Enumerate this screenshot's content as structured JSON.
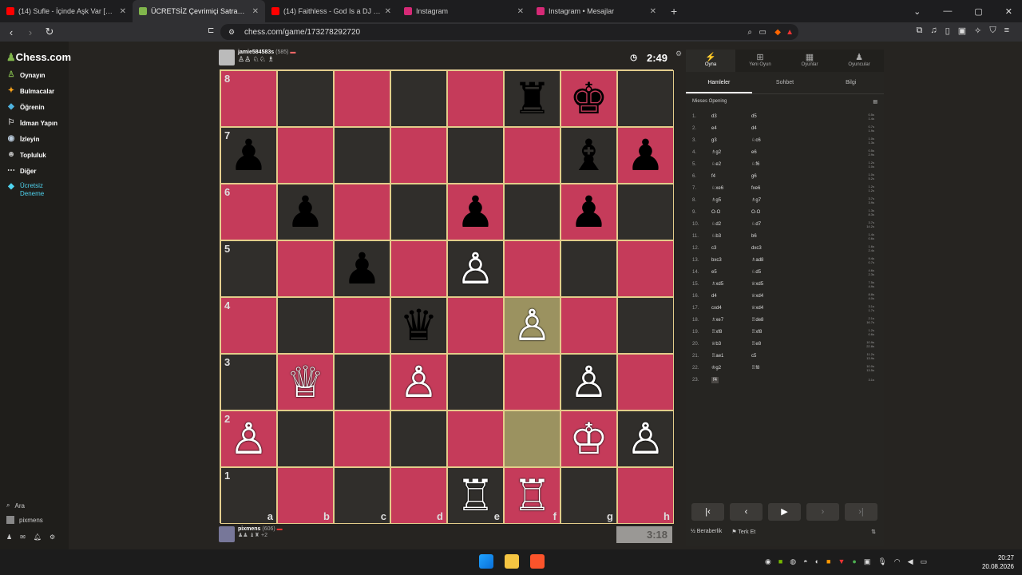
{
  "browser": {
    "tabs": [
      {
        "label": "(14) Sufle - İçinde Aşk Var [Officia",
        "color": "#ff0000",
        "active": false
      },
      {
        "label": "ÜCRETSİZ Çevrimiçi Satranç O",
        "color": "#81b64c",
        "active": true
      },
      {
        "label": "(14) Faithless - God Is a DJ (Official V",
        "color": "#ff0000",
        "active": false
      },
      {
        "label": "Instagram",
        "color": "#d62976",
        "active": false
      },
      {
        "label": "Instagram • Mesajlar",
        "color": "#d62976",
        "active": false
      }
    ],
    "url": "chess.com/game/173278292720"
  },
  "sidebar": {
    "logo": "Chess.com",
    "items": [
      "Oynayın",
      "Bulmacalar",
      "Öğrenin",
      "İdman Yapın",
      "İzleyin",
      "Topluluk",
      "Diğer",
      "Ücretsiz Deneme"
    ],
    "search": "Ara",
    "user": "pixmens"
  },
  "top_player": {
    "name": "jamie584583s",
    "rating": "(585)",
    "timer": "2:49"
  },
  "bottom_player": {
    "name": "pixmens",
    "rating": "(606)",
    "extra": "+2",
    "timer": "3:18"
  },
  "board": {
    "ranks": [
      "8",
      "7",
      "6",
      "5",
      "4",
      "3",
      "2",
      "1"
    ],
    "files": [
      "a",
      "b",
      "c",
      "d",
      "e",
      "f",
      "g",
      "h"
    ],
    "squares": [
      [
        "",
        "",
        "",
        "",
        "",
        "♜",
        "♚",
        ""
      ],
      [
        "♟",
        "",
        "",
        "",
        "",
        "",
        "♝",
        "♟"
      ],
      [
        "",
        "♟",
        "",
        "",
        "♟",
        "",
        "♟",
        ""
      ],
      [
        "",
        "",
        "♟",
        "",
        "♙",
        "",
        "",
        ""
      ],
      [
        "",
        "",
        "",
        "♛",
        "",
        "♙",
        "",
        ""
      ],
      [
        "",
        "♕",
        "",
        "♙",
        "",
        "",
        "♙",
        ""
      ],
      [
        "♙",
        "",
        "",
        "",
        "",
        "",
        "♔",
        "♙"
      ],
      [
        "",
        "",
        "",
        "",
        "♖",
        "♖",
        "",
        ""
      ]
    ]
  },
  "panel": {
    "top_tabs": [
      "Oyna",
      "Yeni Oyun",
      "Oyunlar",
      "Oyuncular"
    ],
    "sub_tabs": [
      "Hamleler",
      "Sohbet",
      "Bilgi"
    ],
    "opening": "Mieses Opening",
    "moves": [
      [
        "1.",
        "d3",
        "d5",
        "0.5s",
        "1.4s"
      ],
      [
        "2.",
        "e4",
        "d4",
        "0.7s",
        "1.9s"
      ],
      [
        "3.",
        "g3",
        "♘c6",
        "1.0s",
        "1.3s"
      ],
      [
        "4.",
        "♗g2",
        "e6",
        "0.5s",
        "2.9s"
      ],
      [
        "5.",
        "♘e2",
        "♘f6",
        "1.2s",
        "1.0s"
      ],
      [
        "6.",
        "f4",
        "g6",
        "1.0s",
        "5.2s"
      ],
      [
        "7.",
        "♘xe6",
        "fxe6",
        "1.2s",
        "1.2s"
      ],
      [
        "8.",
        "♗g5",
        "♗g7",
        "3.7s",
        "3.9s"
      ],
      [
        "9.",
        "O-O",
        "O-O",
        "1.3s",
        "8.3s"
      ],
      [
        "10.",
        "♘d2",
        "♘d7",
        "3.7s",
        "14.2s"
      ],
      [
        "11.",
        "♘b3",
        "b6",
        "1.4s",
        "0.6s"
      ],
      [
        "12.",
        "c3",
        "dxc3",
        "1.6s",
        "2.4s"
      ],
      [
        "13.",
        "bxc3",
        "♗ad8",
        "9.4s",
        "0.7s"
      ],
      [
        "14.",
        "e5",
        "♘d5",
        "4.6s",
        "2.3s"
      ],
      [
        "15.",
        "♗xd5",
        "♕xd5",
        "7.5s",
        "4.9s"
      ],
      [
        "16.",
        "d4",
        "♕xd4",
        "8.8s",
        "4.0s"
      ],
      [
        "17.",
        "cxd4",
        "♕xd4",
        "3.1s",
        "1.7s"
      ],
      [
        "18.",
        "♗xe7",
        "♖de8",
        "2.1s",
        "16.7s"
      ],
      [
        "19.",
        "♖xf8",
        "♖xf8",
        "1.2s",
        "0.6s"
      ],
      [
        "20.",
        "♕b3",
        "♖e8",
        "10.9s",
        "22.8s"
      ],
      [
        "21.",
        "♖ae1",
        "c5",
        "11.2s",
        "13.9s"
      ],
      [
        "22.",
        "♔g2",
        "♖f8",
        "10.0s",
        "13.5s"
      ],
      [
        "23.",
        "f4",
        "",
        "3.1s",
        ""
      ]
    ],
    "draw": "Beraberlik",
    "resign": "Terk Et"
  },
  "taskbar": {
    "time": "20:27",
    "date": "20.08.2026"
  }
}
